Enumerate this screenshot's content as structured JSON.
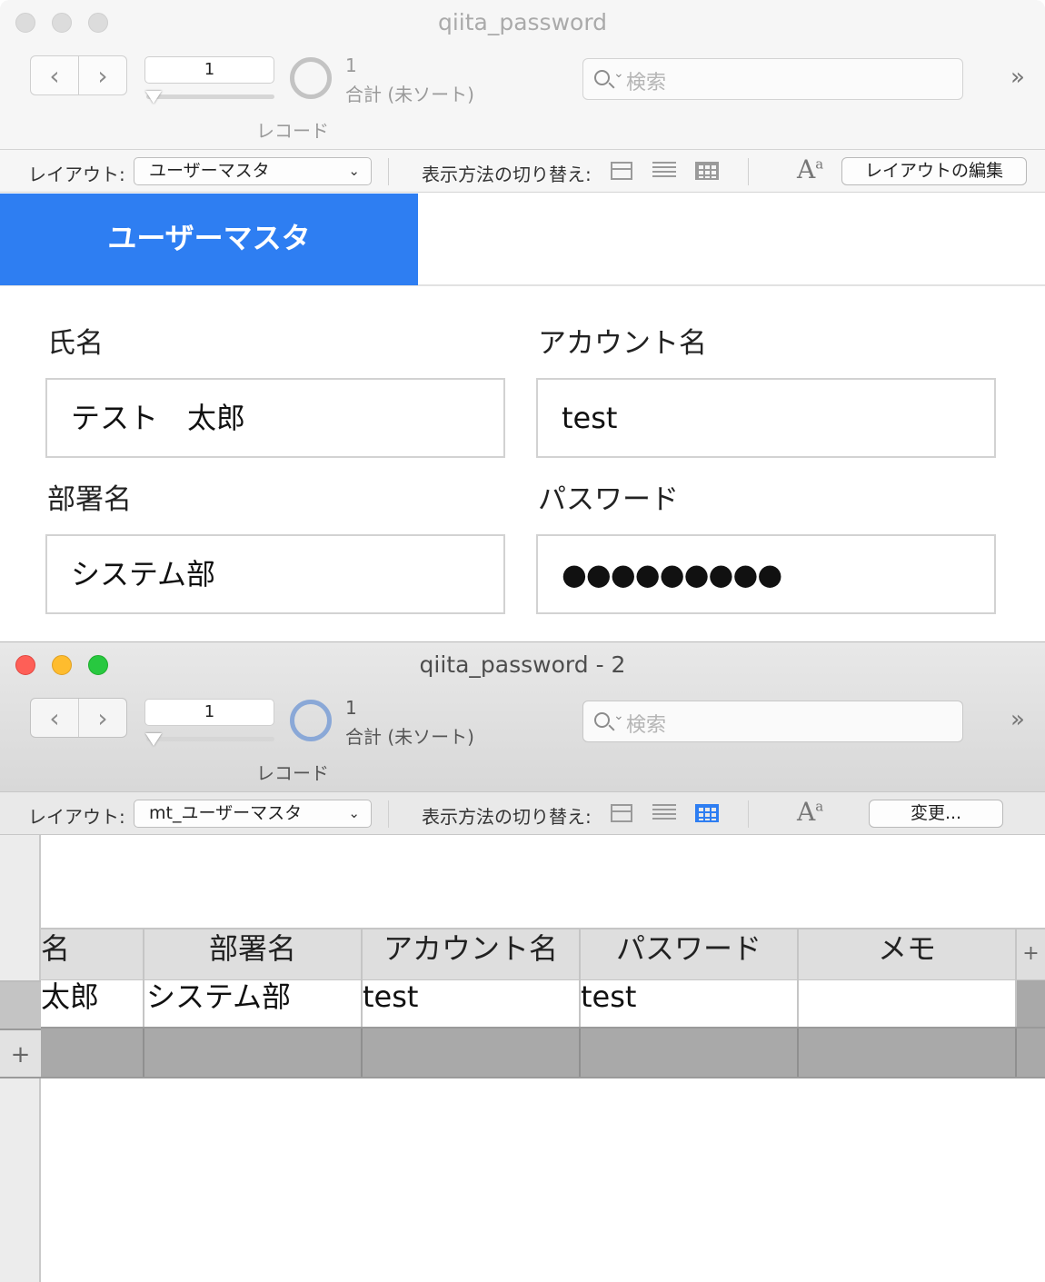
{
  "window1": {
    "title": "qiita_password",
    "record_current": "1",
    "record_label": "レコード",
    "found_count": "1",
    "total_label": "合計 (未ソート)",
    "search_placeholder": "検索",
    "layout_label": "レイアウト:",
    "layout_value": "ユーザーマスタ",
    "view_switch_label": "表示方法の切り替え:",
    "edit_button": "レイアウトの編集",
    "header_title": "ユーザーマスタ",
    "fields": {
      "name_label": "氏名",
      "name_value": "テスト　太郎",
      "account_label": "アカウント名",
      "account_value": "test",
      "dept_label": "部署名",
      "dept_value": "システム部",
      "password_label": "パスワード",
      "password_value": "●●●●●●●●●"
    }
  },
  "window2": {
    "title": "qiita_password - 2",
    "record_current": "1",
    "record_label": "レコード",
    "found_count": "1",
    "total_label": "合計 (未ソート)",
    "search_placeholder": "検索",
    "layout_label": "レイアウト:",
    "layout_value": "mt_ユーザーマスタ",
    "view_switch_label": "表示方法の切り替え:",
    "change_button": "変更...",
    "table": {
      "columns": [
        "名",
        "部署名",
        "アカウント名",
        "パスワード",
        "メモ"
      ],
      "rows": [
        [
          "太郎",
          "システム部",
          "test",
          "test",
          ""
        ]
      ]
    }
  },
  "icons": {
    "nav_prev": "‹",
    "nav_next": "›",
    "more": "»",
    "plus": "+"
  },
  "colors": {
    "accent": "#2e7ef2",
    "close": "#fe5f57",
    "minimize": "#febc2e",
    "maximize": "#28c840"
  }
}
